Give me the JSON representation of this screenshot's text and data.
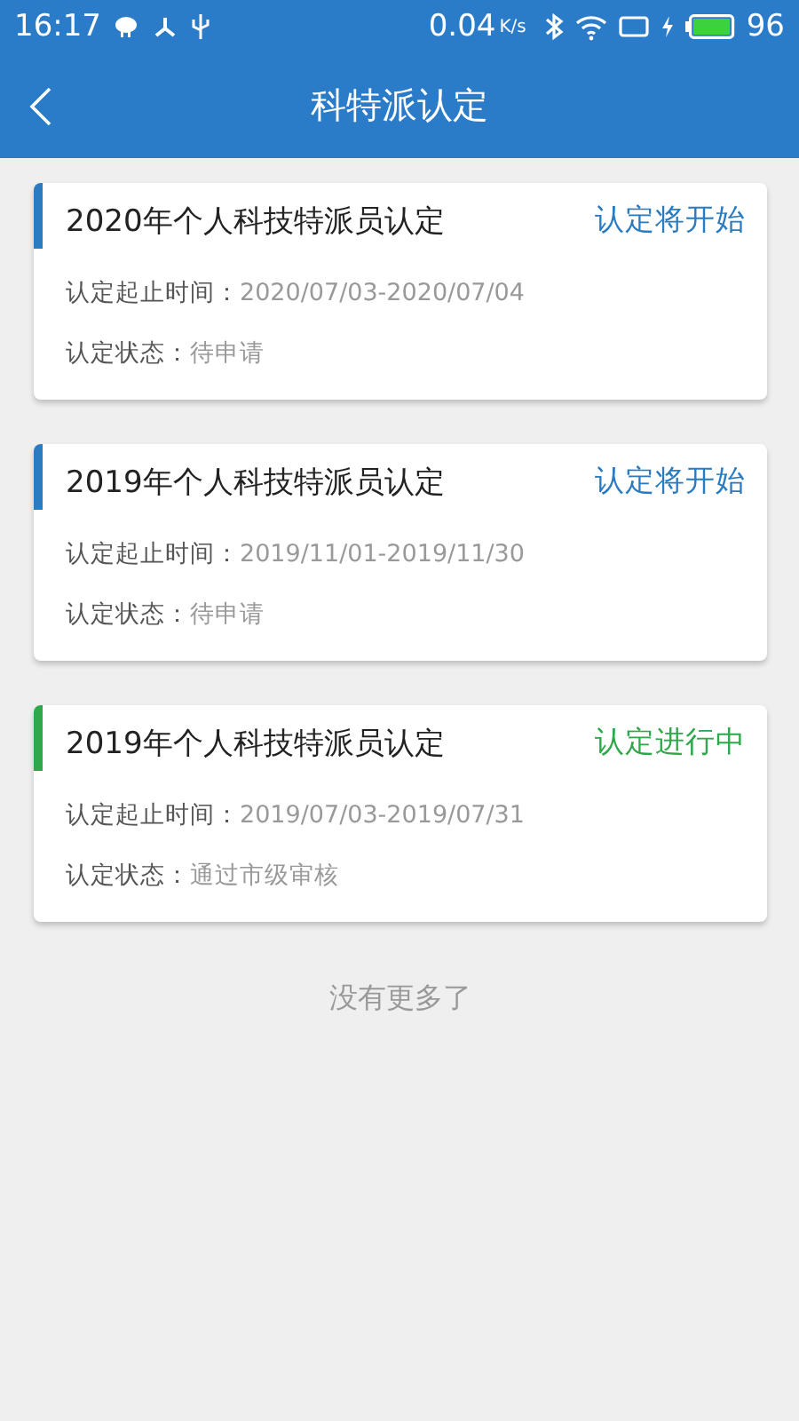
{
  "status_bar": {
    "time": "16:17",
    "speed": "0.04",
    "speed_unit": "K/s",
    "battery": "96"
  },
  "header": {
    "title": "科特派认定"
  },
  "cards": [
    {
      "title": "2020年个人科技特派员认定",
      "status": "认定将开始",
      "color": "#2a7bc0",
      "period_label": "认定起止时间：",
      "period": "2020/07/03-2020/07/04",
      "state_label": "认定状态：",
      "state": "待申请"
    },
    {
      "title": "2019年个人科技特派员认定",
      "status": "认定将开始",
      "color": "#2a7bc0",
      "period_label": "认定起止时间：",
      "period": "2019/11/01-2019/11/30",
      "state_label": "认定状态：",
      "state": "待申请"
    },
    {
      "title": "2019年个人科技特派员认定",
      "status": "认定进行中",
      "color": "#2ea84a",
      "period_label": "认定起止时间：",
      "period": "2019/07/03-2019/07/31",
      "state_label": "认定状态：",
      "state": "通过市级审核"
    }
  ],
  "footer": "没有更多了"
}
